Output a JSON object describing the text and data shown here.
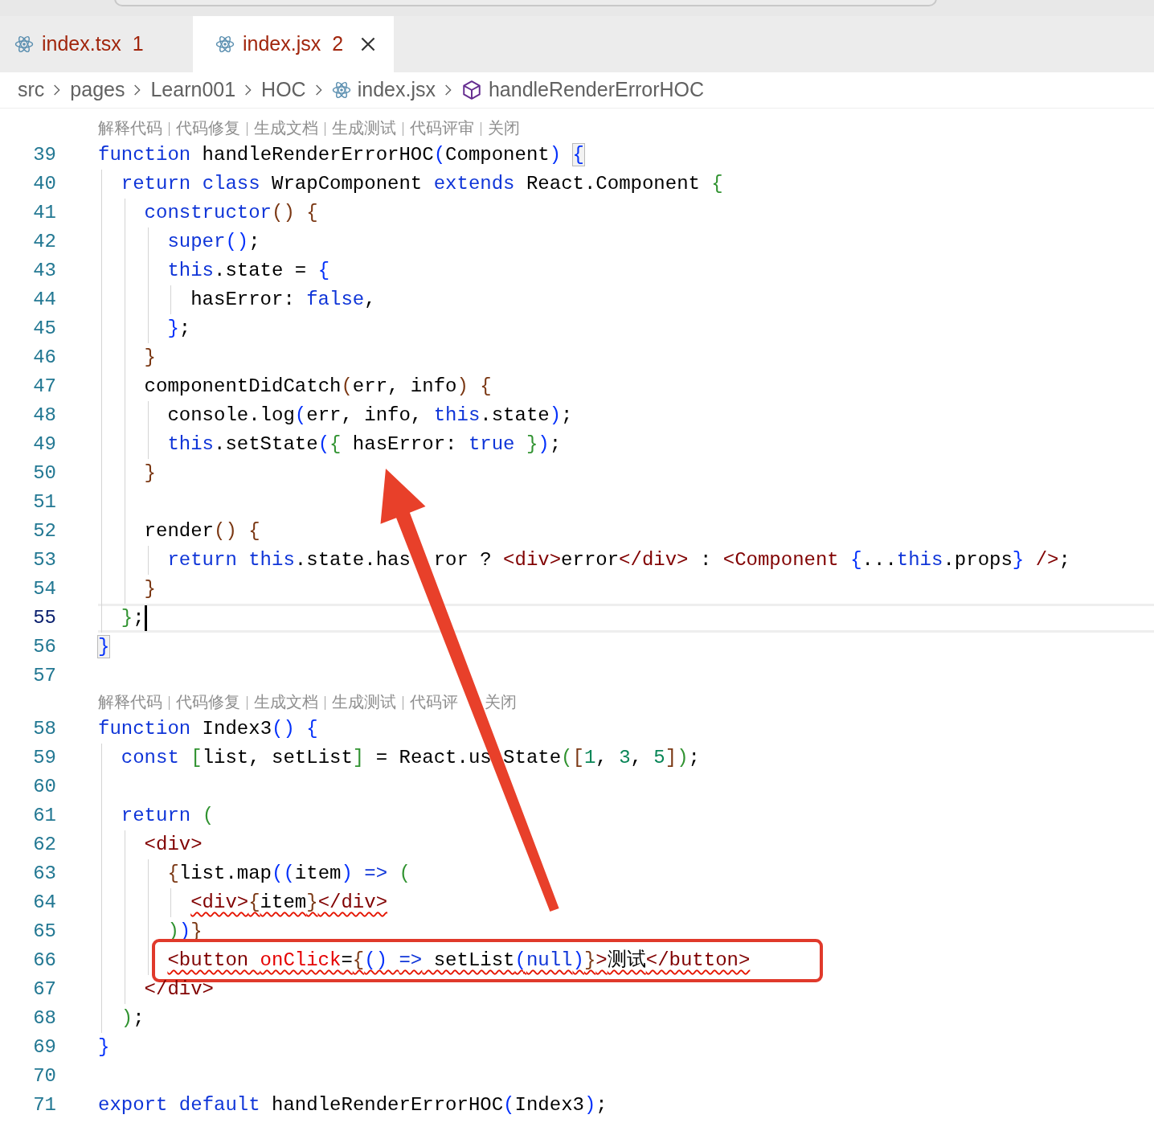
{
  "tabs": [
    {
      "label": "index.tsx",
      "problems": "1",
      "selected": false
    },
    {
      "label": "index.jsx",
      "problems": "2",
      "selected": true
    }
  ],
  "breadcrumb": [
    {
      "label": "src",
      "kind": "folder"
    },
    {
      "label": "pages",
      "kind": "folder"
    },
    {
      "label": "Learn001",
      "kind": "folder"
    },
    {
      "label": "HOC",
      "kind": "folder"
    },
    {
      "label": "index.jsx",
      "kind": "file"
    },
    {
      "label": "handleRenderErrorHOC",
      "kind": "symbol"
    }
  ],
  "lines": [
    {
      "kind": "codelens",
      "actions": [
        {
          "label": "解释代码"
        },
        {
          "label": "代码修复"
        },
        {
          "label": "生成文档"
        },
        {
          "label": "生成测试"
        },
        {
          "label": "代码评审"
        },
        {
          "label": "关闭"
        }
      ]
    },
    {
      "kind": "code",
      "number": "39",
      "current": false,
      "error": false,
      "tokens": [
        {
          "kind": "k",
          "text": "function"
        },
        {
          "kind": "t",
          "text": " handleRenderErrorHOC"
        },
        {
          "kind": "b1",
          "text": "("
        },
        {
          "kind": "t",
          "text": "Component"
        },
        {
          "kind": "b1",
          "text": ") "
        },
        {
          "kind": "bm",
          "text": "{"
        }
      ],
      "children": [
        {
          "kind": "code",
          "number": "40",
          "current": false,
          "error": false,
          "tokens": [
            {
              "kind": "k",
              "text": "return "
            },
            {
              "kind": "k",
              "text": "class"
            },
            {
              "kind": "t",
              "text": " WrapComponent "
            },
            {
              "kind": "k",
              "text": "extends"
            },
            {
              "kind": "t",
              "text": " React.Component "
            },
            {
              "kind": "b2",
              "text": "{"
            }
          ],
          "children": [
            {
              "kind": "code",
              "number": "41",
              "current": false,
              "error": false,
              "tokens": [
                {
                  "kind": "k",
                  "text": "constructor"
                },
                {
                  "kind": "b3",
                  "text": "() "
                },
                {
                  "kind": "b3",
                  "text": "{"
                }
              ],
              "children": [
                {
                  "kind": "code",
                  "number": "42",
                  "current": false,
                  "error": false,
                  "tokens": [
                    {
                      "kind": "k",
                      "text": "super"
                    },
                    {
                      "kind": "b1",
                      "text": "()"
                    },
                    {
                      "kind": "t",
                      "text": ";"
                    }
                  ]
                },
                {
                  "kind": "code",
                  "number": "43",
                  "current": false,
                  "error": false,
                  "tokens": [
                    {
                      "kind": "k",
                      "text": "this"
                    },
                    {
                      "kind": "t",
                      "text": ".state = "
                    },
                    {
                      "kind": "b1",
                      "text": "{"
                    }
                  ],
                  "children": [
                    {
                      "kind": "code",
                      "number": "44",
                      "current": false,
                      "error": false,
                      "tokens": [
                        {
                          "kind": "t",
                          "text": "hasError: "
                        },
                        {
                          "kind": "k",
                          "text": "false"
                        },
                        {
                          "kind": "t",
                          "text": ","
                        }
                      ]
                    }
                  ]
                },
                {
                  "kind": "code",
                  "number": "45",
                  "current": false,
                  "error": false,
                  "tokens": [
                    {
                      "kind": "b1",
                      "text": "}"
                    },
                    {
                      "kind": "t",
                      "text": ";"
                    }
                  ]
                }
              ]
            },
            {
              "kind": "code",
              "number": "46",
              "current": false,
              "error": false,
              "tokens": [
                {
                  "kind": "b3",
                  "text": "}"
                }
              ]
            },
            {
              "kind": "code",
              "number": "47",
              "current": false,
              "error": false,
              "tokens": [
                {
                  "kind": "t",
                  "text": "componentDidCatch"
                },
                {
                  "kind": "b3",
                  "text": "("
                },
                {
                  "kind": "t",
                  "text": "err, info"
                },
                {
                  "kind": "b3",
                  "text": ") "
                },
                {
                  "kind": "b3",
                  "text": "{"
                }
              ],
              "children": [
                {
                  "kind": "code",
                  "number": "48",
                  "current": false,
                  "error": false,
                  "tokens": [
                    {
                      "kind": "t",
                      "text": "console.log"
                    },
                    {
                      "kind": "b1",
                      "text": "("
                    },
                    {
                      "kind": "t",
                      "text": "err, info, "
                    },
                    {
                      "kind": "k",
                      "text": "this"
                    },
                    {
                      "kind": "t",
                      "text": ".state"
                    },
                    {
                      "kind": "b1",
                      "text": ")"
                    },
                    {
                      "kind": "t",
                      "text": ";"
                    }
                  ]
                },
                {
                  "kind": "code",
                  "number": "49",
                  "current": false,
                  "error": false,
                  "tokens": [
                    {
                      "kind": "k",
                      "text": "this"
                    },
                    {
                      "kind": "t",
                      "text": ".setState"
                    },
                    {
                      "kind": "b1",
                      "text": "("
                    },
                    {
                      "kind": "b2",
                      "text": "{"
                    },
                    {
                      "kind": "t",
                      "text": " hasError: "
                    },
                    {
                      "kind": "k",
                      "text": "true "
                    },
                    {
                      "kind": "b2",
                      "text": "}"
                    },
                    {
                      "kind": "b1",
                      "text": ")"
                    },
                    {
                      "kind": "t",
                      "text": ";"
                    }
                  ]
                }
              ]
            },
            {
              "kind": "code",
              "number": "50",
              "current": false,
              "error": false,
              "tokens": [
                {
                  "kind": "b3",
                  "text": "}"
                }
              ]
            },
            {
              "kind": "code",
              "number": "51",
              "current": false
            },
            {
              "kind": "code",
              "number": "52",
              "current": false,
              "error": false,
              "tokens": [
                {
                  "kind": "t",
                  "text": "render"
                },
                {
                  "kind": "b3",
                  "text": "() "
                },
                {
                  "kind": "b3",
                  "text": "{"
                }
              ],
              "children": [
                {
                  "kind": "code",
                  "number": "53",
                  "current": false,
                  "error": false,
                  "tokens": [
                    {
                      "kind": "k",
                      "text": "return "
                    },
                    {
                      "kind": "k",
                      "text": "this"
                    },
                    {
                      "kind": "t",
                      "text": ".state.has"
                    },
                    {
                      "kind": "t_resume_wide",
                      "text": "ror ? "
                    },
                    {
                      "kind": "tag",
                      "text": "<div>"
                    },
                    {
                      "kind": "t",
                      "text": "error"
                    },
                    {
                      "kind": "tag",
                      "text": "</div>"
                    },
                    {
                      "kind": "t",
                      "text": " : "
                    },
                    {
                      "kind": "tag",
                      "text": "<Component "
                    },
                    {
                      "kind": "b1",
                      "text": "{"
                    },
                    {
                      "kind": "t",
                      "text": "..."
                    },
                    {
                      "kind": "k",
                      "text": "this"
                    },
                    {
                      "kind": "t",
                      "text": ".props"
                    },
                    {
                      "kind": "b1",
                      "text": "} "
                    },
                    {
                      "kind": "tag",
                      "text": "/>"
                    },
                    {
                      "kind": "t",
                      "text": ";"
                    }
                  ]
                }
              ]
            },
            {
              "kind": "code",
              "number": "54",
              "current": false,
              "error": false,
              "tokens": [
                {
                  "kind": "b3",
                  "text": "}"
                }
              ]
            }
          ]
        },
        {
          "kind": "code",
          "number": "55",
          "current": true,
          "error": false,
          "tokens": [
            {
              "kind": "b2",
              "text": "}"
            },
            {
              "kind": "t",
              "text": ";"
            }
          ]
        }
      ]
    },
    {
      "kind": "code",
      "number": "56",
      "current": false,
      "error": false,
      "tokens": [
        {
          "kind": "bm",
          "text": "}"
        }
      ]
    },
    {
      "kind": "code",
      "number": "57",
      "current": false
    },
    {
      "kind": "codelens",
      "actions": [
        {
          "label": "解释代码"
        },
        {
          "label": "代码修复"
        },
        {
          "label": "生成文档"
        },
        {
          "label": "生成测试"
        },
        {
          "label": "代码评"
        },
        {
          "label": "关闭",
          "kind": "resume"
        }
      ]
    },
    {
      "kind": "code",
      "number": "58",
      "current": false,
      "error": false,
      "tokens": [
        {
          "kind": "k",
          "text": "function"
        },
        {
          "kind": "t",
          "text": " Index3"
        },
        {
          "kind": "b1",
          "text": "() "
        },
        {
          "kind": "b1",
          "text": "{"
        }
      ],
      "children": [
        {
          "kind": "code",
          "number": "59",
          "current": false,
          "error": false,
          "tokens": [
            {
              "kind": "k",
              "text": "const "
            },
            {
              "kind": "b2",
              "text": "["
            },
            {
              "kind": "t",
              "text": "list, setList"
            },
            {
              "kind": "b2",
              "text": "]"
            },
            {
              "kind": "t",
              "text": " = React.us"
            },
            {
              "kind": "t_resume",
              "text": "State"
            },
            {
              "kind": "b2",
              "text": "("
            },
            {
              "kind": "b3",
              "text": "["
            },
            {
              "kind": "n",
              "text": "1"
            },
            {
              "kind": "t",
              "text": ", "
            },
            {
              "kind": "n",
              "text": "3"
            },
            {
              "kind": "t",
              "text": ", "
            },
            {
              "kind": "n",
              "text": "5"
            },
            {
              "kind": "b3",
              "text": "]"
            },
            {
              "kind": "b2",
              "text": ")"
            },
            {
              "kind": "t",
              "text": ";"
            }
          ]
        },
        {
          "kind": "code",
          "number": "60",
          "current": false
        },
        {
          "kind": "code",
          "number": "61",
          "current": false,
          "error": false,
          "tokens": [
            {
              "kind": "k",
              "text": "return "
            },
            {
              "kind": "b2",
              "text": "("
            }
          ],
          "children": [
            {
              "kind": "code",
              "number": "62",
              "current": false,
              "error": false,
              "tokens": [
                {
                  "kind": "tag",
                  "text": "<div>"
                }
              ],
              "children": [
                {
                  "kind": "code",
                  "number": "63",
                  "current": false,
                  "error": false,
                  "tokens": [
                    {
                      "kind": "b3",
                      "text": "{"
                    },
                    {
                      "kind": "t",
                      "text": "list.map"
                    },
                    {
                      "kind": "b1",
                      "text": "(("
                    },
                    {
                      "kind": "t",
                      "text": "item"
                    },
                    {
                      "kind": "b1",
                      "text": ") "
                    },
                    {
                      "kind": "k",
                      "text": "=> "
                    },
                    {
                      "kind": "b2",
                      "text": "("
                    }
                  ],
                  "children": [
                    {
                      "kind": "code",
                      "number": "64",
                      "current": false,
                      "error": true,
                      "tokens": [
                        {
                          "kind": "tag",
                          "text": "<div>"
                        },
                        {
                          "kind": "b3",
                          "text": "{"
                        },
                        {
                          "kind": "t",
                          "text": "item"
                        },
                        {
                          "kind": "b3",
                          "text": "}"
                        },
                        {
                          "kind": "tag",
                          "text": "</div>"
                        }
                      ]
                    }
                  ]
                },
                {
                  "kind": "code",
                  "number": "65",
                  "current": false,
                  "error": false,
                  "tokens": [
                    {
                      "kind": "b2",
                      "text": ")"
                    },
                    {
                      "kind": "b1",
                      "text": ")"
                    },
                    {
                      "kind": "b3",
                      "text": "}"
                    }
                  ]
                },
                {
                  "kind": "code",
                  "number": "66",
                  "current": false,
                  "error": true,
                  "highlighted": true,
                  "tokens": [
                    {
                      "kind": "tag",
                      "text": "<button "
                    },
                    {
                      "kind": "a",
                      "text": "onClick"
                    },
                    {
                      "kind": "t",
                      "text": "="
                    },
                    {
                      "kind": "b3",
                      "text": "{"
                    },
                    {
                      "kind": "b1",
                      "text": "() "
                    },
                    {
                      "kind": "k",
                      "text": "=>"
                    },
                    {
                      "kind": "t",
                      "text": " setList"
                    },
                    {
                      "kind": "b1",
                      "text": "("
                    },
                    {
                      "kind": "k",
                      "text": "null"
                    },
                    {
                      "kind": "b1",
                      "text": ")"
                    },
                    {
                      "kind": "b3",
                      "text": "}"
                    },
                    {
                      "kind": "tag",
                      "text": ">"
                    },
                    {
                      "kind": "t",
                      "text": "测试"
                    },
                    {
                      "kind": "tag",
                      "text": "</button>"
                    }
                  ]
                }
              ]
            },
            {
              "kind": "code",
              "number": "67",
              "current": false,
              "error": false,
              "tokens": [
                {
                  "kind": "tag",
                  "text": "</div>"
                }
              ]
            }
          ]
        },
        {
          "kind": "code",
          "number": "68",
          "current": false,
          "error": false,
          "tokens": [
            {
              "kind": "b2",
              "text": ")"
            },
            {
              "kind": "t",
              "text": ";"
            }
          ]
        }
      ]
    },
    {
      "kind": "code",
      "number": "69",
      "current": false,
      "error": false,
      "tokens": [
        {
          "kind": "b1",
          "text": "}"
        }
      ]
    },
    {
      "kind": "code",
      "number": "70",
      "current": false
    },
    {
      "kind": "code",
      "number": "71",
      "current": false,
      "error": false,
      "tokens": [
        {
          "kind": "k",
          "text": "export "
        },
        {
          "kind": "k",
          "text": "default"
        },
        {
          "kind": "t",
          "text": " handleRenderErrorHOC"
        },
        {
          "kind": "b1",
          "text": "("
        },
        {
          "kind": "t",
          "text": "Index3"
        },
        {
          "kind": "b1",
          "text": ")"
        },
        {
          "kind": "t",
          "text": ";"
        }
      ]
    }
  ]
}
